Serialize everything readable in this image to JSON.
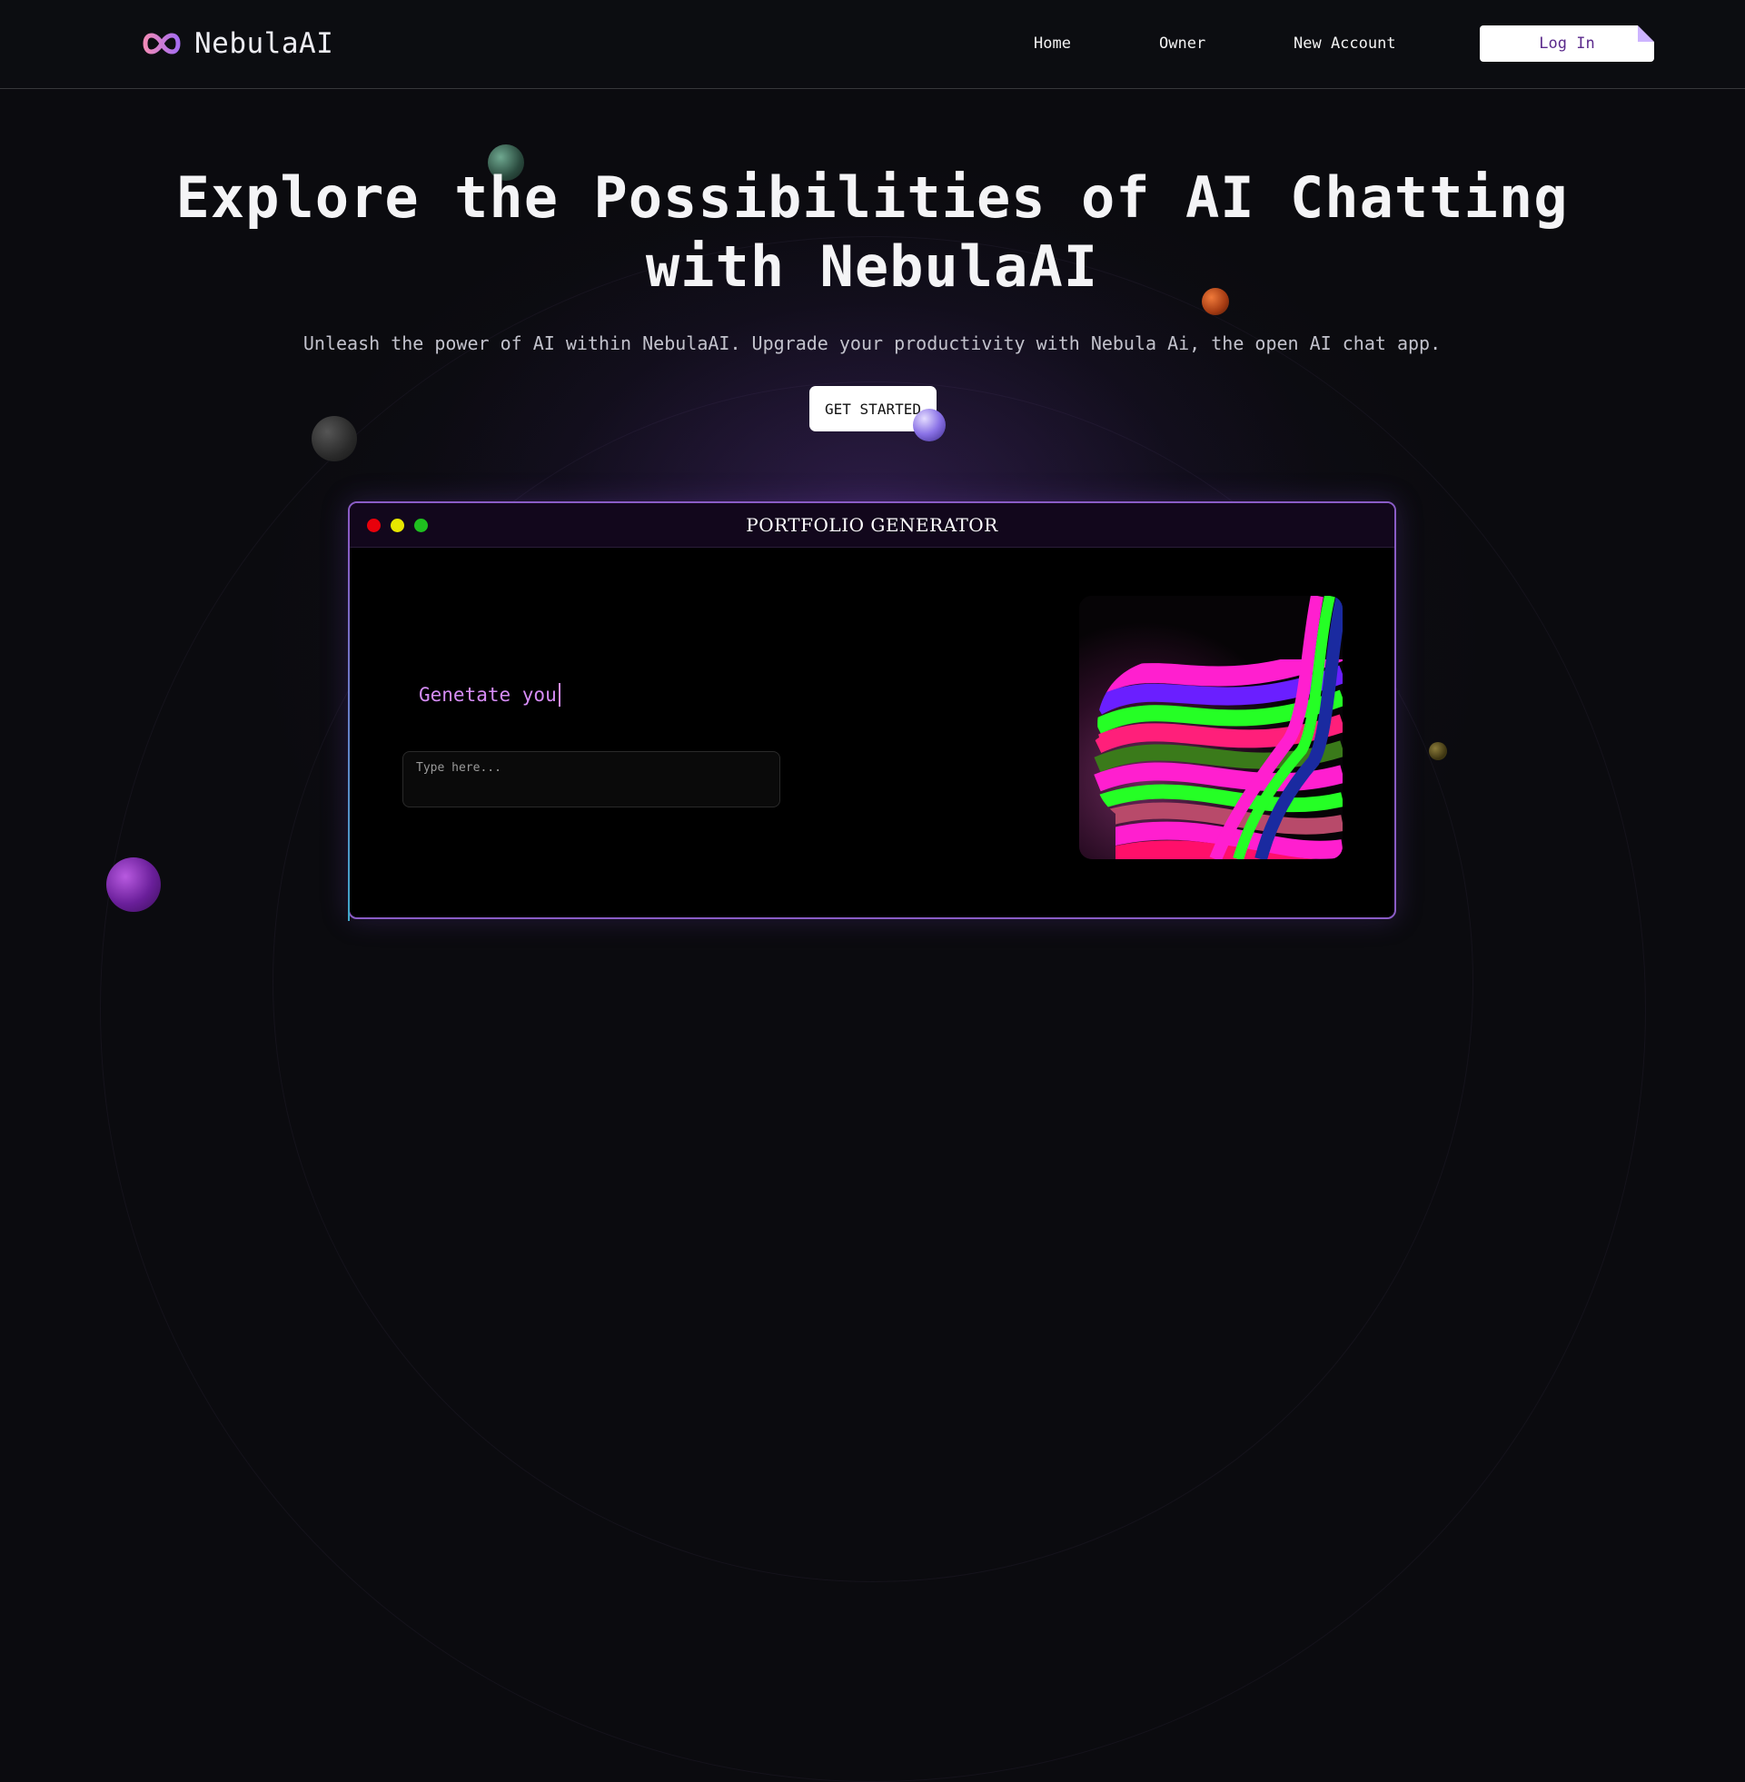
{
  "brand": {
    "name": "NebulaAI"
  },
  "nav": {
    "links": [
      "Home",
      "Owner",
      "New Account"
    ],
    "login_label": "Log In"
  },
  "hero": {
    "title_line1": "Explore the Possibilities of AI Chatting",
    "title_line2": "with NebulaAI",
    "subtitle": "Unleash the power of AI within NebulaAI. Upgrade your productivity with Nebula Ai, the open AI chat app.",
    "cta_label": "GET STARTED"
  },
  "demo_window": {
    "title": "PORTFOLIO GENERATOR",
    "typing_text": "Genetate you",
    "input_placeholder": "Type here...",
    "image_icon": "rainbow-face-profile-art"
  },
  "colors": {
    "background": "#0b0b0f",
    "accent_purple": "#8a5cc6",
    "typing_text": "#d58cf5",
    "login_text": "#5b2a8c",
    "dot_red": "#e8000b",
    "dot_yellow": "#e6e600",
    "dot_green": "#1fbf1f"
  }
}
